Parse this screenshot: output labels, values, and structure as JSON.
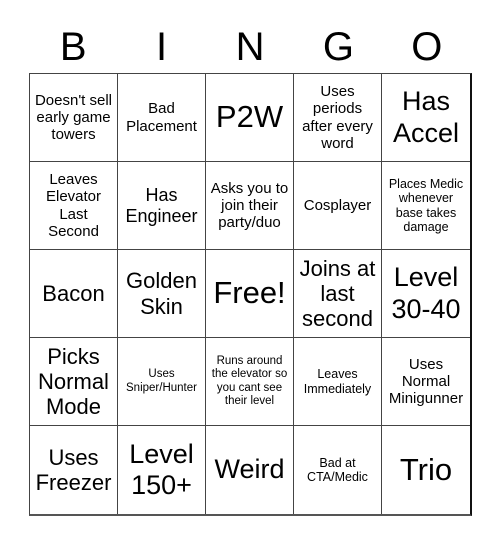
{
  "header": [
    "B",
    "I",
    "N",
    "G",
    "O"
  ],
  "cells": [
    {
      "text": "Doesn't sell early game towers",
      "size": "s-sm"
    },
    {
      "text": "Bad Placement",
      "size": "s-sm"
    },
    {
      "text": "P2W",
      "size": "s-xl"
    },
    {
      "text": "Uses periods after every word",
      "size": "s-sm"
    },
    {
      "text": "Has Accel",
      "size": "s-lg"
    },
    {
      "text": "Leaves Elevator Last Second",
      "size": "s-sm"
    },
    {
      "text": "Has Engineer",
      "size": "s-md"
    },
    {
      "text": "Asks you to join their party/duo",
      "size": "s-sm"
    },
    {
      "text": "Cosplayer",
      "size": "s-sm"
    },
    {
      "text": "Places Medic whenever base takes damage",
      "size": "s-xs"
    },
    {
      "text": "Bacon",
      "size": "s-ml"
    },
    {
      "text": "Golden Skin",
      "size": "s-ml"
    },
    {
      "text": "Free!",
      "size": "s-xl"
    },
    {
      "text": "Joins at last second",
      "size": "s-ml"
    },
    {
      "text": "Level 30-40",
      "size": "s-lg"
    },
    {
      "text": "Picks Normal Mode",
      "size": "s-ml"
    },
    {
      "text": "Uses Sniper/Hunter",
      "size": "s-xxs"
    },
    {
      "text": "Runs around the elevator so you cant see their level",
      "size": "s-xxs"
    },
    {
      "text": "Leaves Immediately",
      "size": "s-xs"
    },
    {
      "text": "Uses Normal Minigunner",
      "size": "s-sm"
    },
    {
      "text": "Uses Freezer",
      "size": "s-ml"
    },
    {
      "text": "Level 150+",
      "size": "s-lg"
    },
    {
      "text": "Weird",
      "size": "s-lg"
    },
    {
      "text": "Bad at CTA/Medic",
      "size": "s-xs"
    },
    {
      "text": "Trio",
      "size": "s-xl"
    }
  ]
}
